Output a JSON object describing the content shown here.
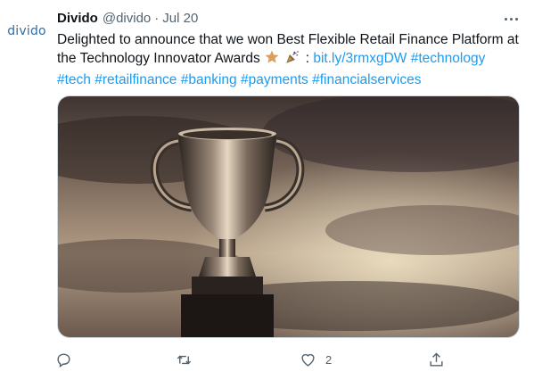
{
  "author": {
    "avatar_text": "divido",
    "name": "Divido",
    "handle": "@divido",
    "separator": "·",
    "date": "Jul 20"
  },
  "tweet": {
    "text": "Delighted to announce that we won Best Flexible Retail Finance Platform at the Technology Innovator Awards",
    "emojis": [
      "star-emoji",
      "party-popper-emoji"
    ],
    "colon": ":",
    "link": "bit.ly/3rmxgDW",
    "hashtags": [
      "#technology",
      "#tech",
      "#retailfinance",
      "#banking",
      "#payments",
      "#financialservices"
    ]
  },
  "media": {
    "description_icon": "trophy-icon"
  },
  "actions": {
    "reply_count": "",
    "retweet_count": "",
    "like_count": "2",
    "share_count": ""
  },
  "colors": {
    "link": "#1d9bf0",
    "muted": "#536471",
    "text": "#0f1419"
  }
}
